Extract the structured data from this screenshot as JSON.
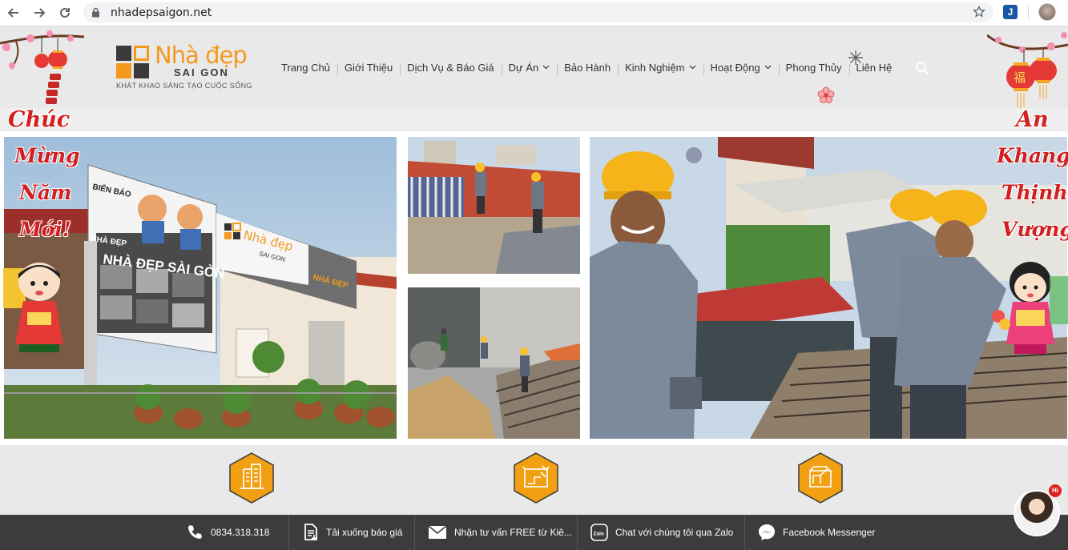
{
  "browser": {
    "url": "nhadepsaigon.net",
    "extension_label": "J"
  },
  "logo": {
    "brand": "Nhà đẹp",
    "sub": "SAI GON",
    "tagline": "KHÁT KHAO SÁNG TẠO CUỘC SỐNG"
  },
  "menu": {
    "items": [
      {
        "label": "Trang Chủ",
        "has_dropdown": false
      },
      {
        "label": "Giới Thiệu",
        "has_dropdown": false
      },
      {
        "label": "Dịch Vụ & Báo Giá",
        "has_dropdown": false
      },
      {
        "label": "Dự Án",
        "has_dropdown": true
      },
      {
        "label": "Bảo Hành",
        "has_dropdown": false
      },
      {
        "label": "Kinh Nghiệm",
        "has_dropdown": true
      },
      {
        "label": "Hoạt Động",
        "has_dropdown": true
      },
      {
        "label": "Phong Thủy",
        "has_dropdown": false
      },
      {
        "label": "Liên Hệ",
        "has_dropdown": false
      }
    ]
  },
  "greetings": {
    "left": [
      "Chúc",
      "Mừng",
      "Năm",
      "Mới!"
    ],
    "right": [
      "An",
      "Khang",
      "Thịnh",
      "Vượng"
    ],
    "lantern_char": "福"
  },
  "billboard": {
    "title": "NHÀ ĐẸP SÀI GÒN",
    "sign_brand": "Nhà đẹp",
    "sign_sub": "SAI GON",
    "sign_name": "NHÀ ĐẸP",
    "sign_left": "BIỂN BÁO",
    "sign_left2": "NHÀ ĐẸP"
  },
  "bottom_bar": {
    "phone": "0834.318.318",
    "download": "Tải xuống báo giá",
    "consult": "Nhận tư vấn FREE từ Kiê...",
    "zalo": "Chat với chúng tôi qua Zalo",
    "messenger": "Facebook Messenger",
    "zalo_icon_text": "Zalo"
  },
  "chat_widget": {
    "badge": "Hi"
  },
  "colors": {
    "accent": "#f39a1d",
    "festive_red": "#d21f1f",
    "bottom_bar": "#3c3c3c"
  }
}
